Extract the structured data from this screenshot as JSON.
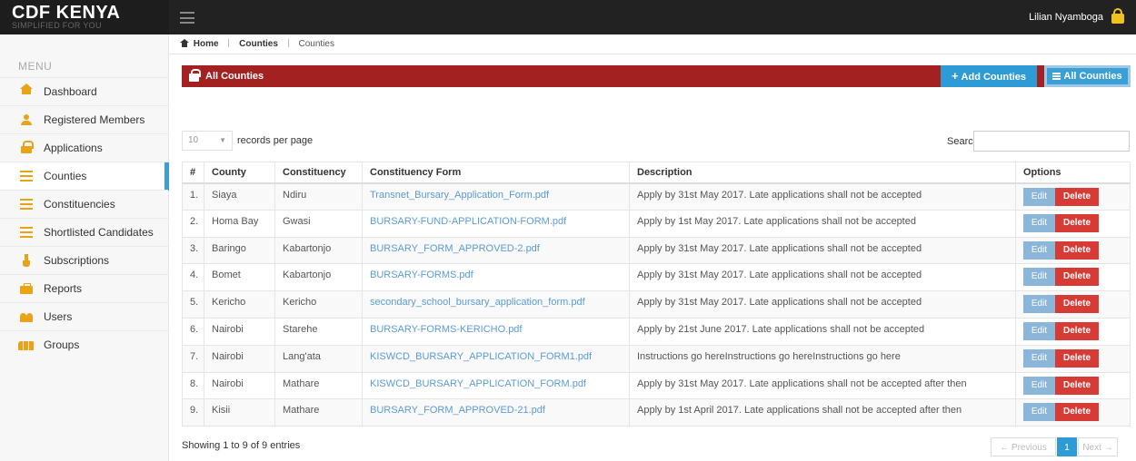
{
  "brand": {
    "title": "CDF KENYA",
    "subtitle": "SIMPLIFIED FOR YOU"
  },
  "topbar": {
    "user_name": "Lilian Nyamboga"
  },
  "sidebar": {
    "menu_title": "MENU",
    "items": [
      {
        "label": "Dashboard",
        "icon": "home-icon"
      },
      {
        "label": "Registered Members",
        "icon": "person-icon"
      },
      {
        "label": "Applications",
        "icon": "lock-icon"
      },
      {
        "label": "Counties",
        "icon": "list-icon",
        "active": true
      },
      {
        "label": "Constituencies",
        "icon": "list-icon"
      },
      {
        "label": "Shortlisted Candidates",
        "icon": "list-icon"
      },
      {
        "label": "Subscriptions",
        "icon": "flask-icon"
      },
      {
        "label": "Reports",
        "icon": "briefcase-icon"
      },
      {
        "label": "Users",
        "icon": "users-icon"
      },
      {
        "label": "Groups",
        "icon": "group-icon"
      }
    ]
  },
  "breadcrumb": {
    "home": "Home",
    "section": "Counties",
    "current": "Counties"
  },
  "panel": {
    "title": "All Counties",
    "add_button": "Add Counties",
    "all_button": "All Counties"
  },
  "table_controls": {
    "page_length": "10",
    "records_label": "records per page",
    "search_label": "Search:",
    "search_value": ""
  },
  "table": {
    "headers": [
      "#",
      "County",
      "Constituency",
      "Constituency Form",
      "Description",
      "Options"
    ],
    "rows": [
      {
        "num": "1.",
        "county": "Siaya",
        "constituency": "Ndiru",
        "form": "Transnet_Bursary_Application_Form.pdf",
        "description": "Apply by 31st May 2017. Late applications shall not be accepted"
      },
      {
        "num": "2.",
        "county": "Homa Bay",
        "constituency": "Gwasi",
        "form": "BURSARY-FUND-APPLICATION-FORM.pdf",
        "description": "Apply by 1st May 2017. Late applications shall not be accepted"
      },
      {
        "num": "3.",
        "county": "Baringo",
        "constituency": "Kabartonjo",
        "form": "BURSARY_FORM_APPROVED-2.pdf",
        "description": "Apply by 31st May 2017. Late applications shall not be accepted"
      },
      {
        "num": "4.",
        "county": "Bomet",
        "constituency": "Kabartonjo",
        "form": "BURSARY-FORMS.pdf",
        "description": "Apply by 31st May 2017. Late applications shall not be accepted"
      },
      {
        "num": "5.",
        "county": "Kericho",
        "constituency": "Kericho",
        "form": "secondary_school_bursary_application_form.pdf",
        "description": "Apply by 31st May 2017. Late applications shall not be accepted"
      },
      {
        "num": "6.",
        "county": "Nairobi",
        "constituency": "Starehe",
        "form": "BURSARY-FORMS-KERICHO.pdf",
        "description": "Apply by 21st June 2017. Late applications shall not be accepted"
      },
      {
        "num": "7.",
        "county": "Nairobi",
        "constituency": "Lang'ata",
        "form": "KISWCD_BURSARY_APPLICATION_FORM1.pdf",
        "description": "Instructions go hereInstructions go hereInstructions go here"
      },
      {
        "num": "8.",
        "county": "Nairobi",
        "constituency": "Mathare",
        "form": "KISWCD_BURSARY_APPLICATION_FORM.pdf",
        "description": "Apply by 31st May 2017. Late applications shall not be accepted after then"
      },
      {
        "num": "9.",
        "county": "Kisii",
        "constituency": "Mathare",
        "form": "BURSARY_FORM_APPROVED-21.pdf",
        "description": "Apply by 1st April 2017. Late applications shall not be accepted after then"
      }
    ],
    "edit_label": "Edit",
    "delete_label": "Delete"
  },
  "footer": {
    "info": "Showing 1 to 9 of 9 entries",
    "prev": "← Previous",
    "page": "1",
    "next": "Next →"
  },
  "colors": {
    "panel_header": "#a32121",
    "accent_blue": "#2f9bd6",
    "delete_red": "#d63c35",
    "edit_blue": "#8cb6d9",
    "icon_gold": "#e8a317"
  }
}
